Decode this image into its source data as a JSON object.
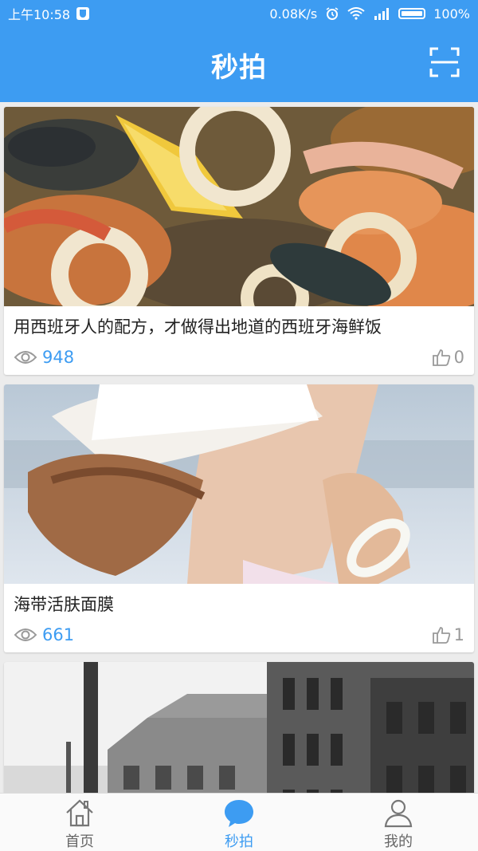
{
  "status": {
    "time": "上午10:58",
    "speed": "0.08K/s",
    "battery": "100%"
  },
  "header": {
    "title": "秒拍"
  },
  "feed": [
    {
      "caption": "用西班牙人的配方，才做得出地道的西班牙海鲜饭",
      "views": "948",
      "likes": "0"
    },
    {
      "caption": "海带活肤面膜",
      "views": "661",
      "likes": "1"
    }
  ],
  "tabs": [
    {
      "label": "首页"
    },
    {
      "label": "秒拍"
    },
    {
      "label": "我的"
    }
  ],
  "colors": {
    "accent": "#3d9cf2",
    "muted": "#999999"
  }
}
